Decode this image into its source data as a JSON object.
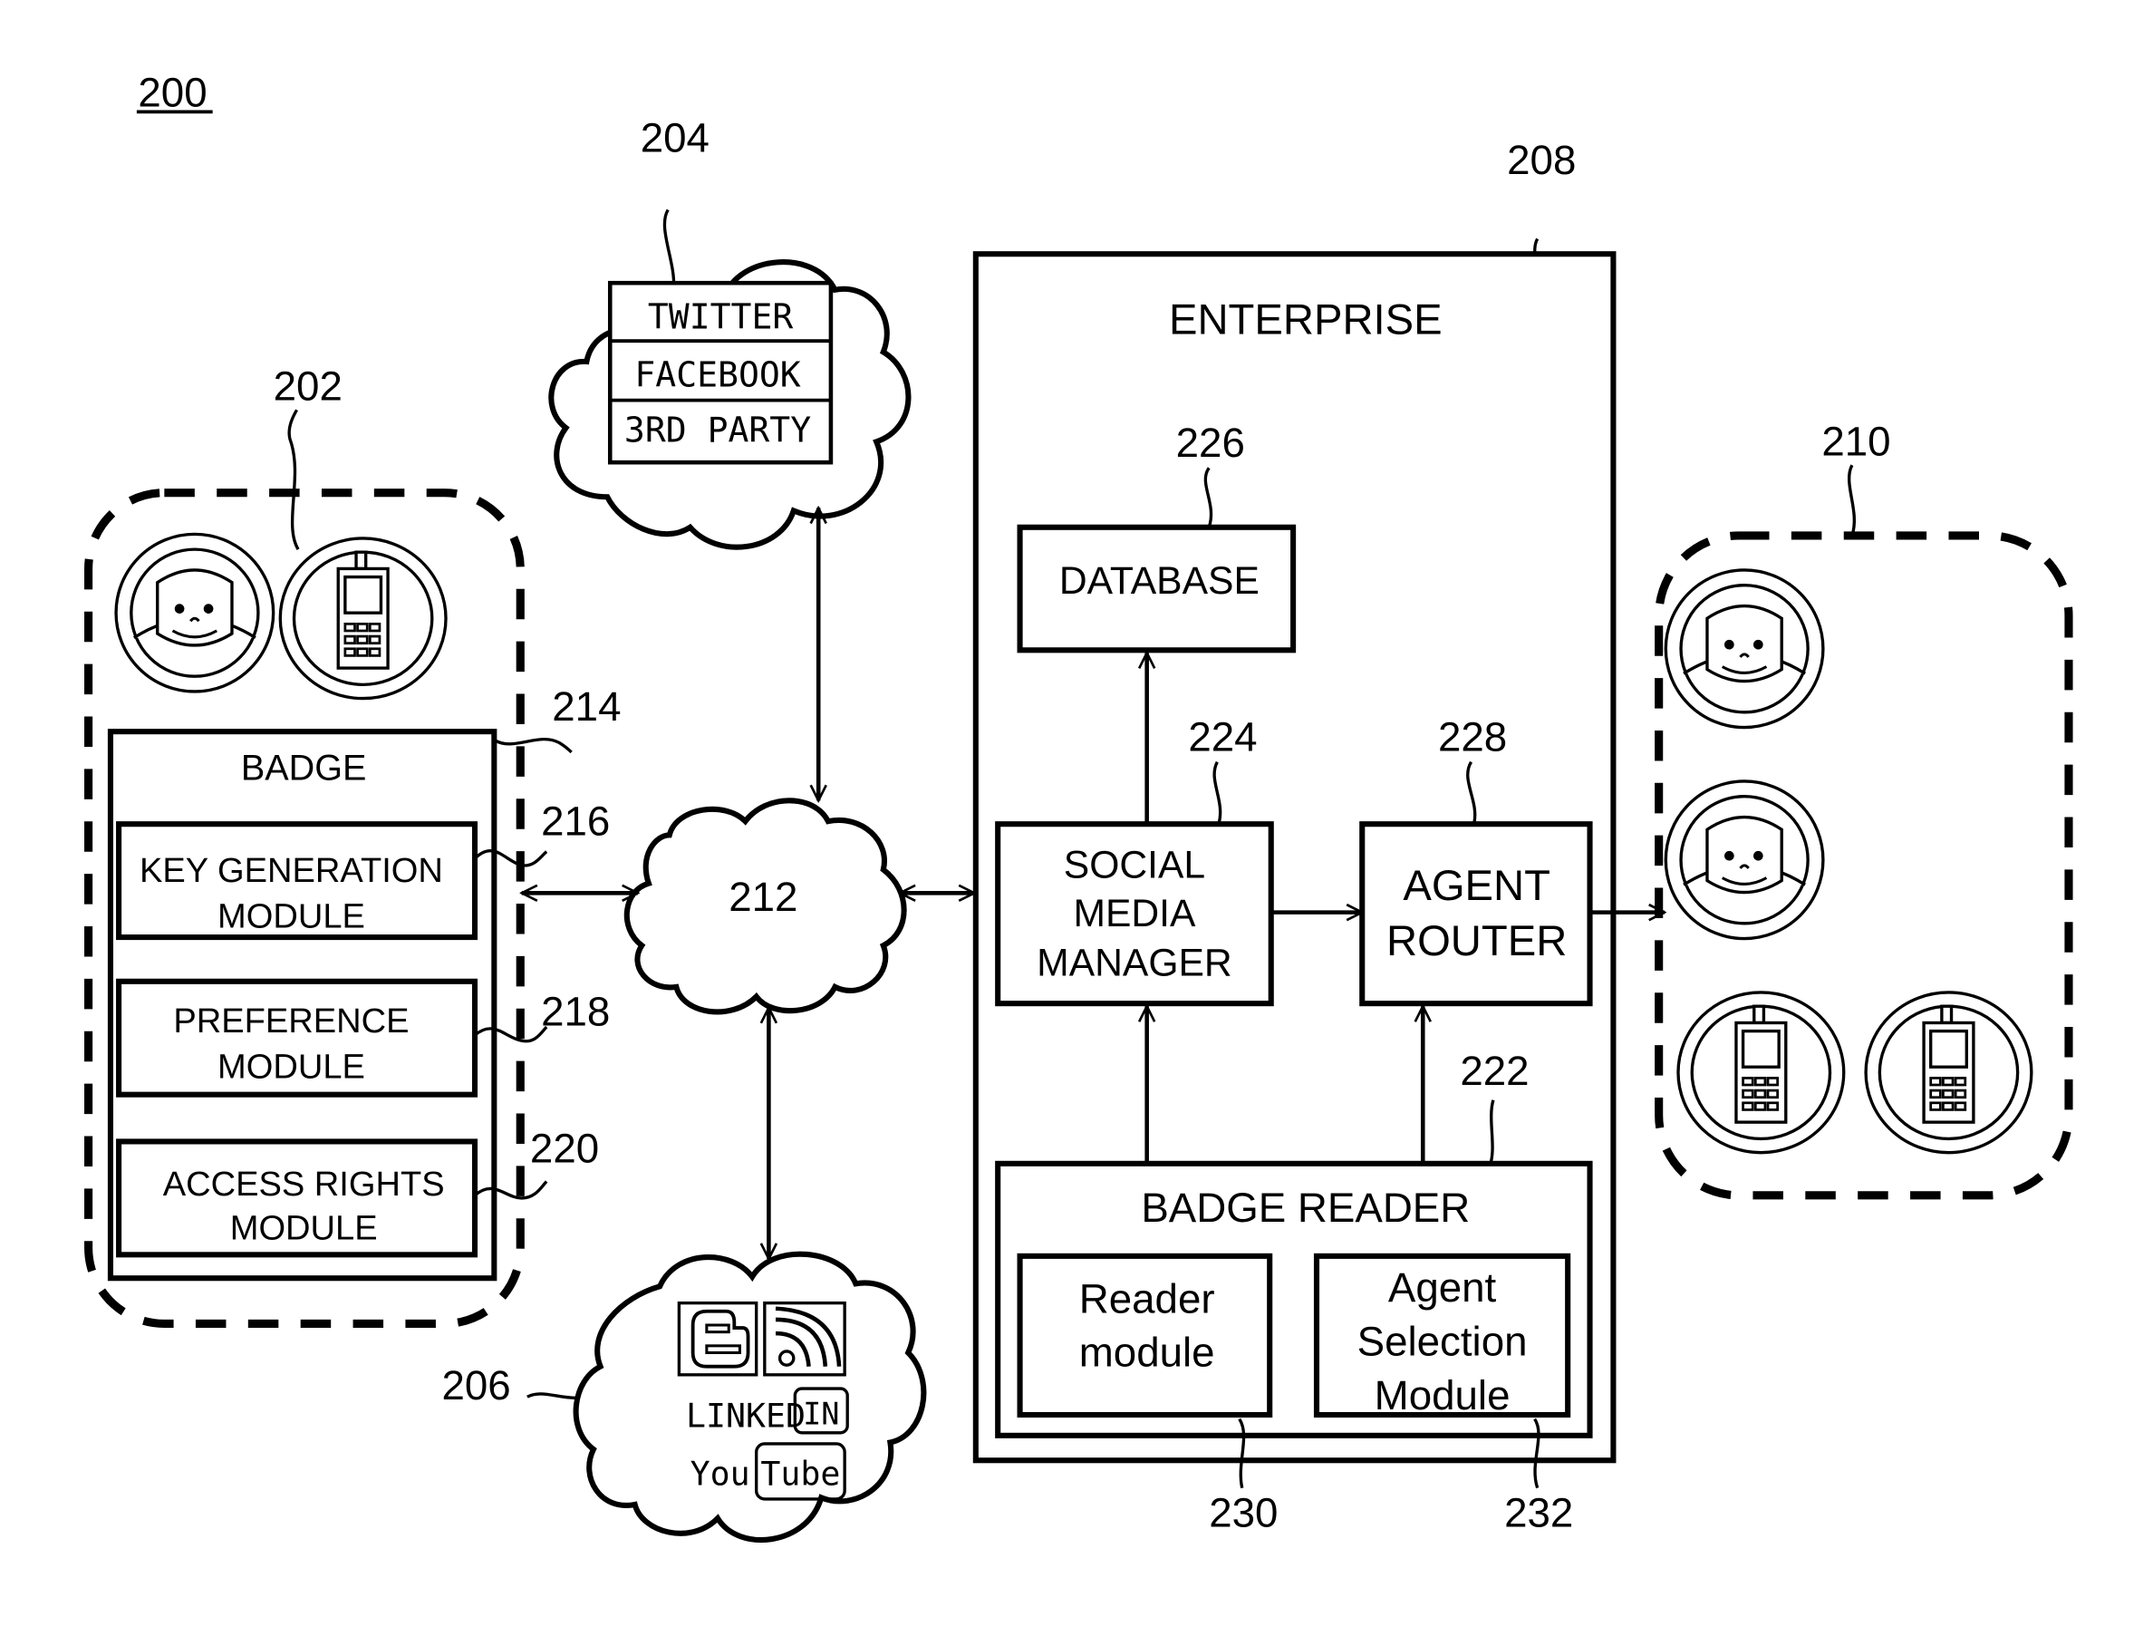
{
  "figure": {
    "number": "200",
    "refs": {
      "badge_holder": "202",
      "social_cloud_top": "204",
      "social_cloud_bottom": "206",
      "enterprise": "208",
      "agents": "210",
      "network": "212",
      "badge": "214",
      "key_generation": "216",
      "preference": "218",
      "access_rights": "220",
      "badge_reader": "222",
      "social_media_manager": "224",
      "database": "226",
      "agent_router": "228",
      "reader_module": "230",
      "agent_selection": "232"
    }
  },
  "badge": {
    "title": "BADGE",
    "modules": [
      {
        "line1": "KEY GENERATION",
        "line2": "MODULE"
      },
      {
        "line1": "PREFERENCE",
        "line2": "MODULE"
      },
      {
        "line1": "ACCESS RIGHTS",
        "line2": "MODULE"
      }
    ]
  },
  "social_top": {
    "services": [
      "TWITTER",
      "FACEBOOK",
      "3RD PARTY"
    ]
  },
  "social_bottom": {
    "icons": [
      "blogger-icon",
      "rss-icon"
    ],
    "linkedin": {
      "text": "LINKED",
      "badge": "IN"
    },
    "youtube": {
      "text": "You",
      "badge": "Tube"
    }
  },
  "enterprise": {
    "title": "ENTERPRISE",
    "database": "DATABASE",
    "social_media_manager": [
      "SOCIAL",
      "MEDIA",
      "MANAGER"
    ],
    "agent_router": [
      "AGENT",
      "ROUTER"
    ],
    "badge_reader": {
      "title": "BADGE READER",
      "reader_module": [
        "Reader",
        "module"
      ],
      "agent_selection": [
        "Agent",
        "Selection",
        "Module"
      ]
    }
  }
}
